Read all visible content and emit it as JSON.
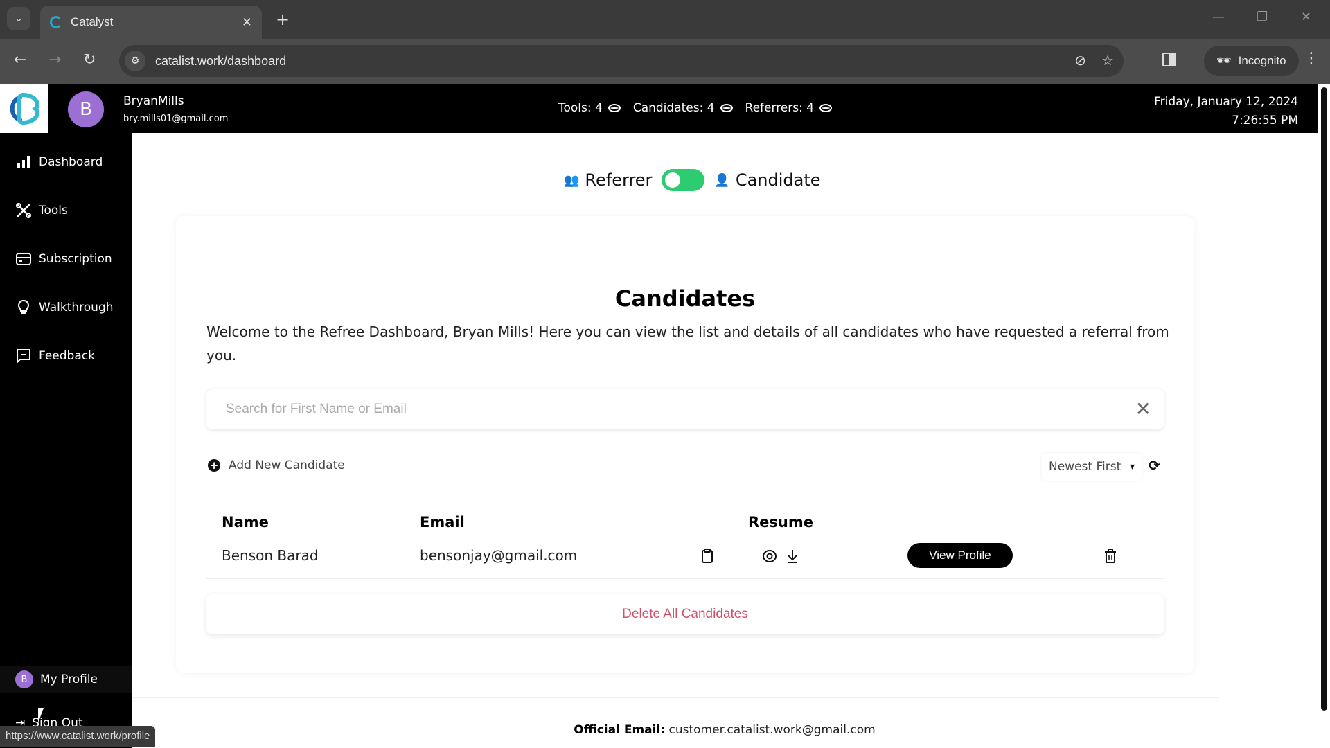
{
  "browser": {
    "tab_title": "Catalyst",
    "url": "catalist.work/dashboard",
    "incognito_label": "Incognito",
    "status_url": "https://www.catalist.work/profile"
  },
  "header": {
    "avatar_letter": "B",
    "user_name": "BryanMills",
    "user_email": "bry.mills01@gmail.com",
    "stats": [
      {
        "label": "Tools: 4"
      },
      {
        "label": "Candidates: 4"
      },
      {
        "label": "Referrers: 4"
      }
    ],
    "date": "Friday, January 12, 2024",
    "time": "7:26:55 PM"
  },
  "sidebar": {
    "items": [
      {
        "label": "Dashboard",
        "icon": "bar-chart-icon"
      },
      {
        "label": "Tools",
        "icon": "tools-icon"
      },
      {
        "label": "Subscription",
        "icon": "credit-card-icon"
      },
      {
        "label": "Walkthrough",
        "icon": "lightbulb-icon"
      },
      {
        "label": "Feedback",
        "icon": "chat-icon"
      }
    ],
    "profile_label": "My Profile",
    "profile_avatar_letter": "B",
    "signout_label": "Sign Out"
  },
  "toggle": {
    "left_label": "Referrer",
    "right_label": "Candidate",
    "state": "on",
    "color": "#2ecc71"
  },
  "main": {
    "title": "Candidates",
    "description": "Welcome to the Refree Dashboard, Bryan Mills! Here you can view the list and details of all candidates who have requested a referral from you.",
    "search": {
      "placeholder": "Search for First Name or Email",
      "value": ""
    },
    "add_new_label": "Add New Candidate",
    "sort": {
      "selected": "Newest First"
    },
    "table": {
      "headers": [
        "Name",
        "Email",
        "Resume"
      ],
      "rows": [
        {
          "name": "Benson Barad",
          "email": "bensonjay@gmail.com",
          "action_label": "View Profile"
        }
      ]
    },
    "delete_all_label": "Delete All Candidates",
    "delete_color": "#d0506a"
  },
  "footer": {
    "label": "Official Email:",
    "email": "customer.catalist.work@gmail.com"
  }
}
